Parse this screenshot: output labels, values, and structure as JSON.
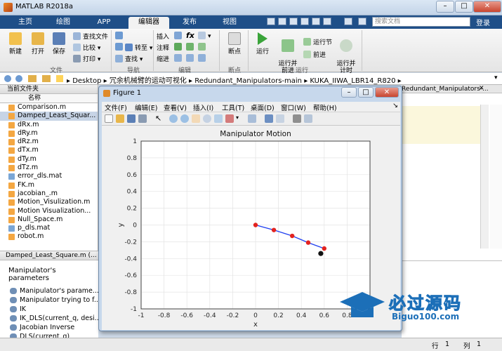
{
  "window": {
    "title": "MATLAB R2018a"
  },
  "tabs": [
    "主页",
    "绘图",
    "APP",
    "编辑器",
    "发布",
    "视图"
  ],
  "active_tab": "编辑器",
  "search": {
    "placeholder": "搜索文档"
  },
  "login_label": "登录",
  "ribbon": {
    "file": {
      "new": "新建",
      "open": "打开",
      "save": "保存",
      "find_files": "查找文件",
      "compare": "比较",
      "print": "打印",
      "section": "文件"
    },
    "nav": {
      "goto": "转至",
      "find": "查找",
      "section": "导航"
    },
    "edit": {
      "insert": "插入",
      "comment": "注释",
      "indent": "缩进",
      "section": "编辑"
    },
    "breakpoints": {
      "label": "断点",
      "section": "断点"
    },
    "run": {
      "run": "运行",
      "run_advance": "运行并\n前进",
      "run_section": "运行节",
      "advance": "前进",
      "run_time": "运行并\n计时",
      "section": "运行"
    }
  },
  "address": {
    "path": "▸ Desktop ▸ 冗余机械臂的运动可视化 ▸ Redundant_Manipulators-main ▸ KUKA_IIWA_LBR14_R820 ▸"
  },
  "current_folder": {
    "header": "当前文件夹",
    "col_name": "名称",
    "files": [
      {
        "name": "Comparison.m",
        "type": "m"
      },
      {
        "name": "Damped_Least_Squar...",
        "type": "m",
        "selected": true
      },
      {
        "name": "dRx.m",
        "type": "m"
      },
      {
        "name": "dRy.m",
        "type": "m"
      },
      {
        "name": "dRz.m",
        "type": "m"
      },
      {
        "name": "dTx.m",
        "type": "m"
      },
      {
        "name": "dTy.m",
        "type": "m"
      },
      {
        "name": "dTz.m",
        "type": "m"
      },
      {
        "name": "error_dls.mat",
        "type": "mat"
      },
      {
        "name": "FK.m",
        "type": "m"
      },
      {
        "name": "jacobian_.m",
        "type": "m"
      },
      {
        "name": "Motion_Visulization.m",
        "type": "m"
      },
      {
        "name": "Motion Visualization...",
        "type": "m"
      },
      {
        "name": "Null_Space.m",
        "type": "m"
      },
      {
        "name": "p_dls.mat",
        "type": "mat"
      },
      {
        "name": "robot.m",
        "type": "m"
      }
    ]
  },
  "details": {
    "header": "Damped_Least_Square.m (...",
    "title": "Manipulator's parameters",
    "items": [
      "Manipulator's parame...",
      "Manipulator trying to f...",
      "IK",
      "IK_DLS(current_q, desi...",
      "Jacobian Inverse",
      "DLS(current_q)"
    ]
  },
  "editor_tab_fragment": "Redundant_Manipulators-...",
  "status": {
    "row_label": "行",
    "row": "1",
    "col_label": "列",
    "col": "1"
  },
  "figure": {
    "title": "Figure 1",
    "menus": [
      "文件(F)",
      "编辑(E)",
      "查看(V)",
      "插入(I)",
      "工具(T)",
      "桌面(D)",
      "窗口(W)",
      "帮助(H)"
    ]
  },
  "chart_data": {
    "type": "line",
    "title": "Manipulator Motion",
    "xlabel": "x",
    "ylabel": "y",
    "xlim": [
      -1,
      1
    ],
    "ylim": [
      -1,
      1
    ],
    "xticks": [
      "-1",
      "-0.8",
      "-0.6",
      "-0.4",
      "-0.2",
      "0",
      "0.2",
      "0.4",
      "0.6",
      "0.8",
      "1"
    ],
    "yticks": [
      "-1",
      "-0.8",
      "-0.6",
      "-0.4",
      "-0.2",
      "0",
      "0.2",
      "0.4",
      "0.6",
      "0.8",
      "1"
    ],
    "grid": true,
    "series": [
      {
        "x": [
          0,
          0.16,
          0.32,
          0.46,
          0.6
        ],
        "y": [
          0,
          -0.06,
          -0.13,
          -0.21,
          -0.28
        ],
        "line_color": "#1f3ff0",
        "marker_color": "#e3231f"
      }
    ],
    "end_effector": {
      "x": 0.57,
      "y": -0.34,
      "color": "#111111"
    }
  },
  "watermark": {
    "text": "必过源码",
    "url": "Biguo100.com"
  },
  "colors": {
    "ribbon_blue": "#1f4f88",
    "figure_frame": "#c7d8ec"
  }
}
